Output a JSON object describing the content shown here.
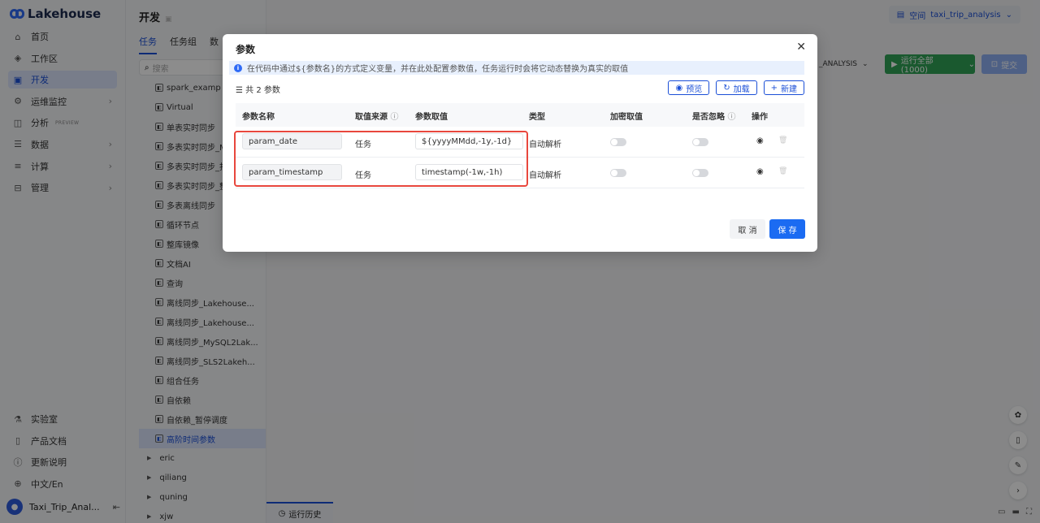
{
  "app": {
    "name": "Lakehouse"
  },
  "sidebar": {
    "items": [
      {
        "label": "首页",
        "icon": "home-icon",
        "glyph": "⌂",
        "chevron": false
      },
      {
        "label": "工作区",
        "icon": "cube-icon",
        "glyph": "◈",
        "chevron": false
      },
      {
        "label": "开发",
        "icon": "code-icon",
        "glyph": "▣",
        "chevron": false,
        "active": true
      },
      {
        "label": "运维监控",
        "icon": "monitor-icon",
        "glyph": "⚙",
        "chevron": true
      },
      {
        "label": "分析",
        "icon": "chart-icon",
        "glyph": "◫",
        "chevron": false,
        "badge": "PREVIEW"
      },
      {
        "label": "数据",
        "icon": "database-icon",
        "glyph": "☰",
        "chevron": true
      },
      {
        "label": "计算",
        "icon": "compute-icon",
        "glyph": "≡",
        "chevron": true
      },
      {
        "label": "管理",
        "icon": "manage-icon",
        "glyph": "⊟",
        "chevron": true
      }
    ],
    "bottom_items": [
      {
        "label": "实验室",
        "icon": "flask-icon",
        "glyph": "⚗"
      },
      {
        "label": "产品文档",
        "icon": "book-icon",
        "glyph": "▯"
      },
      {
        "label": "更新说明",
        "icon": "info-icon",
        "glyph": "ⓘ"
      },
      {
        "label": "中文/En",
        "icon": "globe-icon",
        "glyph": "⊕"
      }
    ],
    "user": "Taxi_Trip_Anal..."
  },
  "dev_panel": {
    "title": "开发",
    "tabs": [
      "任务",
      "任务组",
      "数"
    ],
    "search_placeholder": "搜索",
    "tree": [
      {
        "label": "spark_examp",
        "type": "task"
      },
      {
        "label": "Virtual",
        "type": "task"
      },
      {
        "label": "单表实时同步",
        "type": "task"
      },
      {
        "label": "多表实时同步_M",
        "type": "task"
      },
      {
        "label": "多表实时同步_打",
        "type": "task"
      },
      {
        "label": "多表实时同步_整",
        "type": "task"
      },
      {
        "label": "多表离线同步",
        "type": "task"
      },
      {
        "label": "循环节点",
        "type": "task"
      },
      {
        "label": "整库镜像",
        "type": "task"
      },
      {
        "label": "文档AI",
        "type": "task"
      },
      {
        "label": "查询",
        "type": "task"
      },
      {
        "label": "离线同步_Lakehouse...",
        "type": "task"
      },
      {
        "label": "离线同步_Lakehouse...",
        "type": "task"
      },
      {
        "label": "离线同步_MySQL2Lak...",
        "type": "task"
      },
      {
        "label": "离线同步_SLS2Lakeh...",
        "type": "task"
      },
      {
        "label": "组合任务",
        "type": "task"
      },
      {
        "label": "自依赖",
        "type": "task"
      },
      {
        "label": "自依赖_暂停调度",
        "type": "task"
      },
      {
        "label": "高阶时间参数",
        "type": "task",
        "selected": true
      },
      {
        "label": "eric",
        "type": "folder"
      },
      {
        "label": "qiliang",
        "type": "folder"
      },
      {
        "label": "quning",
        "type": "folder"
      },
      {
        "label": "xjw",
        "type": "folder"
      }
    ]
  },
  "topbar": {
    "space_label": "空间",
    "space_value": "taxi_trip_analysis",
    "analysis_select": "_ANALYSIS",
    "run_all": "运行全部 (1000)",
    "submit": "提交",
    "bottom_tab": "运行历史"
  },
  "modal": {
    "title": "参数",
    "info": "在代码中通过${参数名}的方式定义变量，并在此处配置参数值，任务运行时会将它动态替换为真实的取值",
    "count": "共 2 参数",
    "buttons": {
      "preview": "预览",
      "load": "加载",
      "new": "新建"
    },
    "columns": [
      "参数名称",
      "取值来源",
      "参数取值",
      "类型",
      "加密取值",
      "是否忽略",
      "操作"
    ],
    "rows": [
      {
        "name": "param_date",
        "source": "任务",
        "value": "${yyyyMMdd,-1y,-1d}",
        "type": "自动解析",
        "encrypted": false,
        "ignored": false
      },
      {
        "name": "param_timestamp",
        "source": "任务",
        "value": "timestamp(-1w,-1h)",
        "type": "自动解析",
        "encrypted": false,
        "ignored": false
      }
    ],
    "cancel": "取 消",
    "save": "保 存"
  }
}
